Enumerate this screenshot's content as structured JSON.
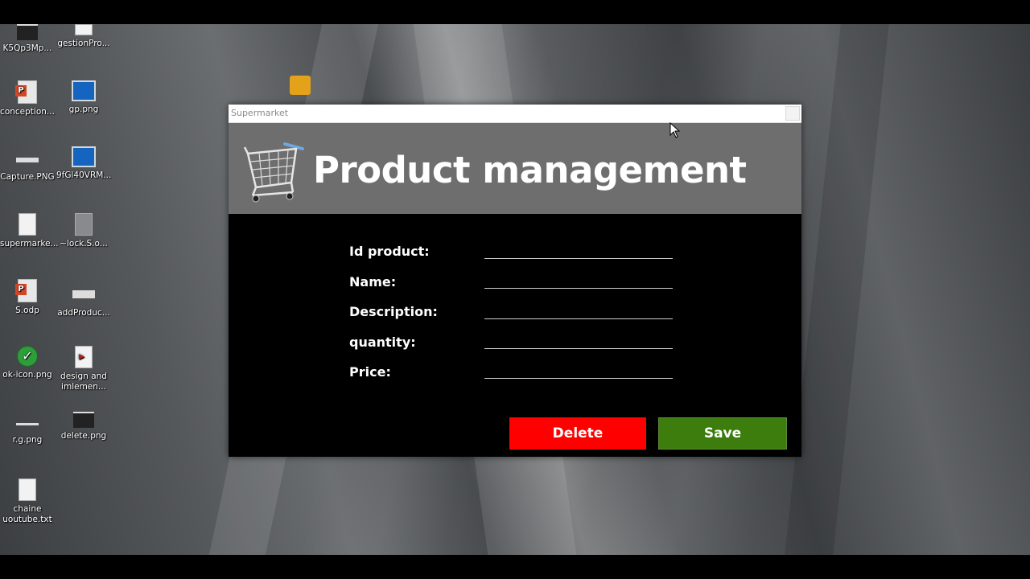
{
  "desktop": {
    "icons": [
      {
        "label": "K5Qp3Mp...",
        "icon": "image-file-icon"
      },
      {
        "label": "gestionPro...",
        "icon": "document-icon"
      },
      {
        "label": "conception...",
        "icon": "powerpoint-icon"
      },
      {
        "label": "gp.png",
        "icon": "png-image-icon"
      },
      {
        "label": "Capture.PNG",
        "icon": "image-file-icon"
      },
      {
        "label": "9fGl40VRM...",
        "icon": "png-image-icon"
      },
      {
        "label": "supermarke...",
        "icon": "document-icon"
      },
      {
        "label": "~lock.S.o...",
        "icon": "lock-file-icon"
      },
      {
        "label": "S.odp",
        "icon": "powerpoint-icon"
      },
      {
        "label": "addProduc...",
        "icon": "image-file-icon"
      },
      {
        "label": "ok-icon.png",
        "icon": "ok-check-icon"
      },
      {
        "label": "design and imlemen...",
        "icon": "video-file-icon"
      },
      {
        "label": "r.g.png",
        "icon": "image-file-icon"
      },
      {
        "label": "delete.png",
        "icon": "image-file-icon"
      },
      {
        "label": "chaine uoutube.txt",
        "icon": "text-file-icon"
      }
    ]
  },
  "window": {
    "title": "Supermarket",
    "banner_title": "Product management",
    "banner_icon": "shopping-cart-icon",
    "colors": {
      "banner": "#6e6e6e",
      "body": "#000000",
      "delete": "#ff0000",
      "save": "#3c7d0e"
    }
  },
  "form": {
    "fields": [
      {
        "label": "Id product:",
        "value": ""
      },
      {
        "label": "Name:",
        "value": ""
      },
      {
        "label": "Description:",
        "value": ""
      },
      {
        "label": "quantity:",
        "value": ""
      },
      {
        "label": "Price:",
        "value": ""
      }
    ]
  },
  "actions": {
    "delete_label": "Delete",
    "save_label": "Save"
  }
}
